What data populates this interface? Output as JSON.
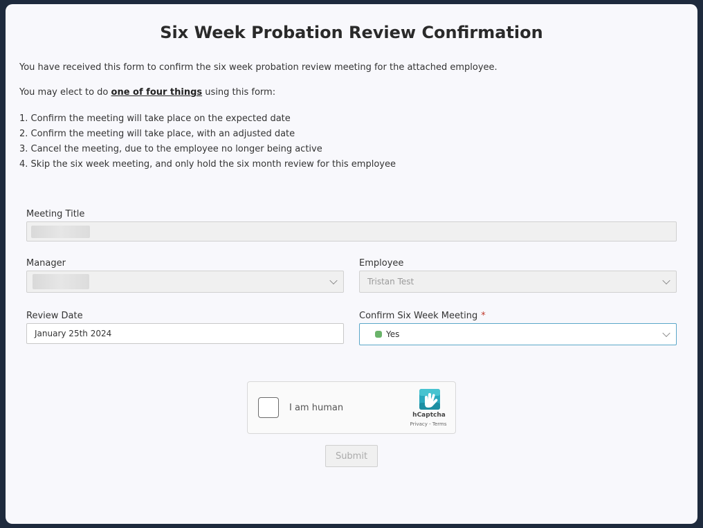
{
  "form": {
    "title": "Six Week Probation Review Confirmation",
    "intro_line": "You have received this form to confirm the six week probation review meeting for the attached employee.",
    "elect_prefix": "You may elect to do ",
    "elect_emphasis": "one of four things",
    "elect_suffix": " using this form:",
    "options": [
      "1. Confirm the meeting will take place on the expected date",
      "2. Confirm the meeting will take place, with an adjusted date",
      "3. Cancel the meeting, due to the employee no longer being active",
      "4. Skip the six week meeting, and only hold the six month review for this employee"
    ]
  },
  "fields": {
    "meeting_title": {
      "label": "Meeting Title",
      "value": ""
    },
    "manager": {
      "label": "Manager",
      "value": ""
    },
    "employee": {
      "label": "Employee",
      "value": "Tristan Test"
    },
    "review_date": {
      "label": "Review Date",
      "value": "January 25th 2024"
    },
    "confirm": {
      "label": "Confirm Six Week Meeting",
      "required_mark": "*",
      "value": "Yes",
      "status_color": "#6ab36a"
    }
  },
  "captcha": {
    "label": "I am human",
    "brand": "hCaptcha",
    "links": "Privacy - Terms"
  },
  "submit_label": "Submit",
  "colors": {
    "accent_focus": "#5aa6c8",
    "background": "#1e2a3d",
    "card": "#f8f8fc"
  }
}
